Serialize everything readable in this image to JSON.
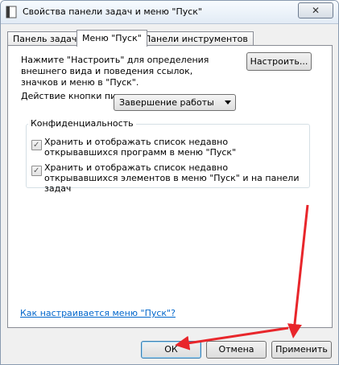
{
  "window": {
    "title": "Свойства панели задач и меню \"Пуск\"",
    "close_symbol": "✕"
  },
  "tabs": [
    {
      "label": "Панель задач",
      "active": false
    },
    {
      "label": "Меню \"Пуск\"",
      "active": true
    },
    {
      "label": "Панели инструментов",
      "active": false
    }
  ],
  "start_menu": {
    "description": "Нажмите \"Настроить\" для определения внешнего вида и поведения ссылок, значков и меню в \"Пуск\".",
    "customize_button": "Настроить...",
    "power_label": "Действие кнопки питания:",
    "power_value": "Завершение работы",
    "privacy": {
      "title": "Конфиденциальность",
      "checkboxes": [
        {
          "label": "Хранить и отображать список недавно открывавшихся программ в меню \"Пуск\"",
          "checked": true
        },
        {
          "label": "Хранить и отображать список недавно открывавшихся элементов в меню \"Пуск\" и на панели задач",
          "checked": true
        }
      ]
    },
    "help_link": "Как настраивается меню \"Пуск\"?"
  },
  "buttons": {
    "ok": "ОК",
    "cancel": "Отмена",
    "apply": "Применить"
  },
  "annotation_color": "#e8262b",
  "icons": [
    "taskbar-app-icon",
    "close-icon",
    "chevron-down-icon",
    "checkmark-icon",
    "red-arrow-icon"
  ]
}
